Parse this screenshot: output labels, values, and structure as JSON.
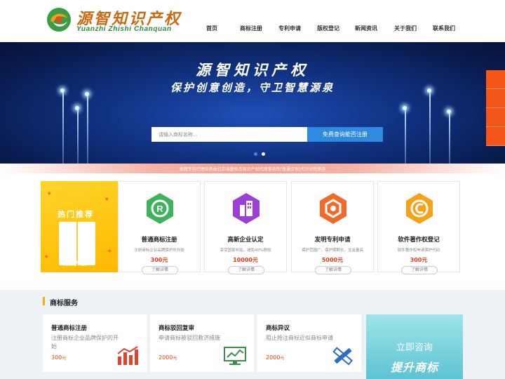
{
  "brand": {
    "name_cn": "源智知识产权",
    "name_en": "Yuanzhi Zhishi Chanquan"
  },
  "nav": [
    "首页",
    "商标注册",
    "专利申请",
    "版权登记",
    "新闻资讯",
    "关于我们",
    "联系我们"
  ],
  "banner": {
    "title": "源智知识产权",
    "subtitle": "保护创意创造，守卫智慧源泉",
    "search_placeholder": "请输入商标名称...",
    "search_button": "免费查询能否注册",
    "notice": "本网专利代理业务由北京瑞盛拓杰知识产权代理事务所(普通合伙)大兴分所承办"
  },
  "hot": {
    "promo_title": "热门推荐",
    "promo_sub": "知识产权",
    "cards": [
      {
        "title": "普通商标注册",
        "desc": "注册商标企业品牌保护的开始",
        "price": "300元",
        "button": "了解详情",
        "icon": "trademark-r-icon",
        "color": "#3fb35a"
      },
      {
        "title": "高新企业认定",
        "desc": "享受国家补贴，减免40%税收",
        "price": "10000元",
        "button": "了解详情",
        "icon": "building-icon",
        "color": "#9b3fd6"
      },
      {
        "title": "发明专利申请",
        "desc": "保护范围广，保护期期长，含金量高",
        "price": "5000元",
        "button": "了解详情",
        "icon": "patent-icon",
        "color": "#f06a2a"
      },
      {
        "title": "软件著作权登记",
        "desc": "软件著作权申请保护代码",
        "price": "300元",
        "button": "了解详情",
        "icon": "copyright-icon",
        "color": "#f5a316"
      }
    ]
  },
  "services": {
    "title": "商标服务",
    "items": [
      {
        "name": "普通商标注册",
        "desc": "注册商标企业品牌保护的开始",
        "price": "300",
        "unit": "元",
        "icon": "bar-chart-icon"
      },
      {
        "name": "商标驳回复审",
        "desc": "申请商标被驳回救济措施",
        "price": "2000",
        "unit": "元",
        "icon": "monitor-chart-icon"
      },
      {
        "name": "商标异议",
        "desc": "阻止抢注商标近似商标申请",
        "price": "2000",
        "unit": "元",
        "icon": "ruler-pencil-icon"
      }
    ],
    "consult_title": "立即咨询",
    "consult_sub": "提升商标"
  }
}
